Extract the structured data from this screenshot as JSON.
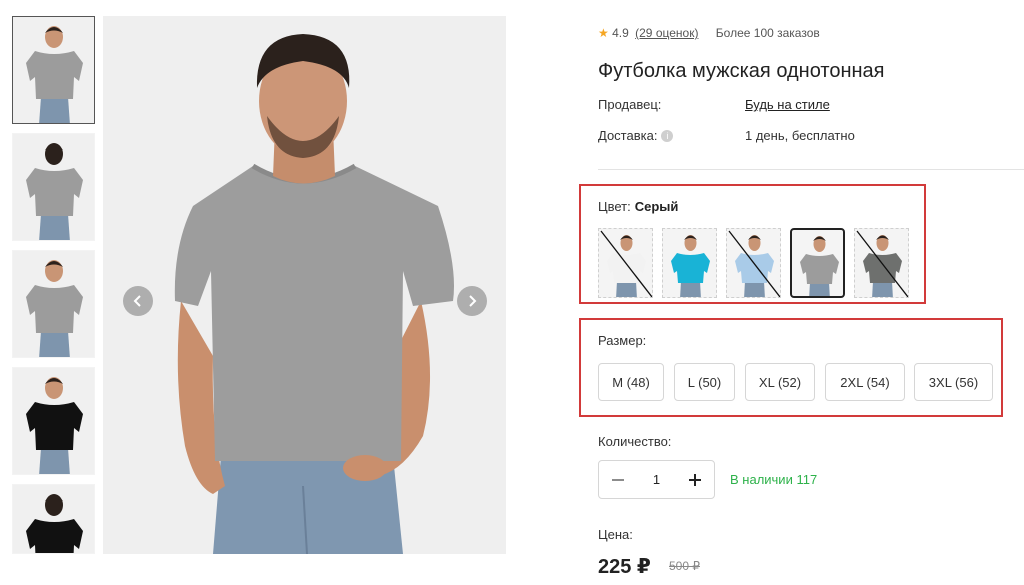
{
  "product": {
    "rating": "4.9",
    "reviews": "(29 оценок)",
    "orders": "Более 100 заказов",
    "title": "Футболка мужская однотонная",
    "seller_label": "Продавец:",
    "seller_name": "Будь на стиле",
    "delivery_label": "Доставка:",
    "delivery_value": "1 день, бесплатно"
  },
  "color": {
    "label": "Цвет:",
    "selected": "Серый",
    "swatches": [
      {
        "name": "white",
        "shirt": "#f2f2f2",
        "available": false
      },
      {
        "name": "turquoise",
        "shirt": "#19b3d6",
        "available": true
      },
      {
        "name": "light-blue",
        "shirt": "#a9cbe8",
        "available": false
      },
      {
        "name": "gray",
        "shirt": "#9c9c9c",
        "available": true,
        "selected": true
      },
      {
        "name": "dark-gray",
        "shirt": "#6e706e",
        "available": false
      }
    ]
  },
  "size": {
    "label": "Размер:",
    "options": [
      "M (48)",
      "L (50)",
      "XL (52)",
      "2XL (54)",
      "3XL (56)"
    ]
  },
  "quantity": {
    "label": "Количество:",
    "value": "1",
    "stock": "В наличии 117"
  },
  "price": {
    "label": "Цена:",
    "current": "225 ₽",
    "old": "500 ₽"
  },
  "gallery": {
    "thumbnails": [
      {
        "shirt": "#9c9c9c",
        "view": "front",
        "active": true
      },
      {
        "shirt": "#9c9c9c",
        "view": "back"
      },
      {
        "shirt": "#9c9c9c",
        "view": "side"
      },
      {
        "shirt": "#111111",
        "view": "front"
      },
      {
        "shirt": "#111111",
        "view": "back"
      }
    ]
  },
  "colors": {
    "accent_red": "#d23a3a",
    "stock_green": "#2db24a",
    "rating_star": "#f5a623"
  },
  "icons": {
    "rating": "star-icon",
    "delivery_info": "info-icon",
    "prev": "chevron-left-icon",
    "next": "chevron-right-icon",
    "minus": "minus-icon",
    "plus": "plus-icon"
  }
}
